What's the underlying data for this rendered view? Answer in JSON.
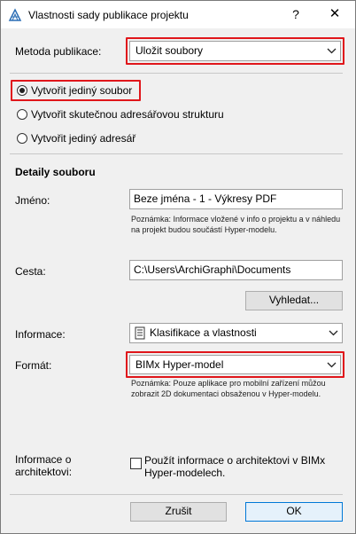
{
  "window": {
    "title": "Vlastnosti sady publikace projektu",
    "help_label": "?",
    "close_label": "✕"
  },
  "method": {
    "label": "Metoda publikace:",
    "value": "Uložit soubory"
  },
  "radios": [
    {
      "label": "Vytvořit jediný soubor",
      "checked": true
    },
    {
      "label": "Vytvořit skutečnou adresářovou strukturu",
      "checked": false
    },
    {
      "label": "Vytvořit jediný adresář",
      "checked": false
    }
  ],
  "details": {
    "heading": "Detaily souboru",
    "name_label": "Jméno:",
    "name_value": "Beze jména - 1 - Výkresy PDF",
    "name_note_1": "Poznámka: Informace vložené v info o projektu a v náhledu",
    "name_note_2": "na projekt budou součástí Hyper-modelu.",
    "path_label": "Cesta:",
    "path_value": "C:\\Users\\ArchiGraphi\\Documents",
    "browse_label": "Vyhledat...",
    "info_label": "Informace:",
    "info_value": "Klasifikace a vlastnosti",
    "format_label": "Formát:",
    "format_value": "BIMx Hyper-model",
    "format_note_1": "Poznámka: Pouze aplikace pro mobilní zařízení můžou",
    "format_note_2": "zobrazit 2D dokumentaci obsaženou v Hyper-modelu.",
    "architect_label_1": "Informace o",
    "architect_label_2": "architektovi:",
    "architect_check_1": "Použít informace o architektovi v BIMx",
    "architect_check_2": "Hyper-modelech.",
    "architect_checked": false
  },
  "buttons": {
    "cancel": "Zrušit",
    "ok": "OK"
  },
  "colors": {
    "highlight": "#e0161b",
    "accent": "#0078d7"
  }
}
